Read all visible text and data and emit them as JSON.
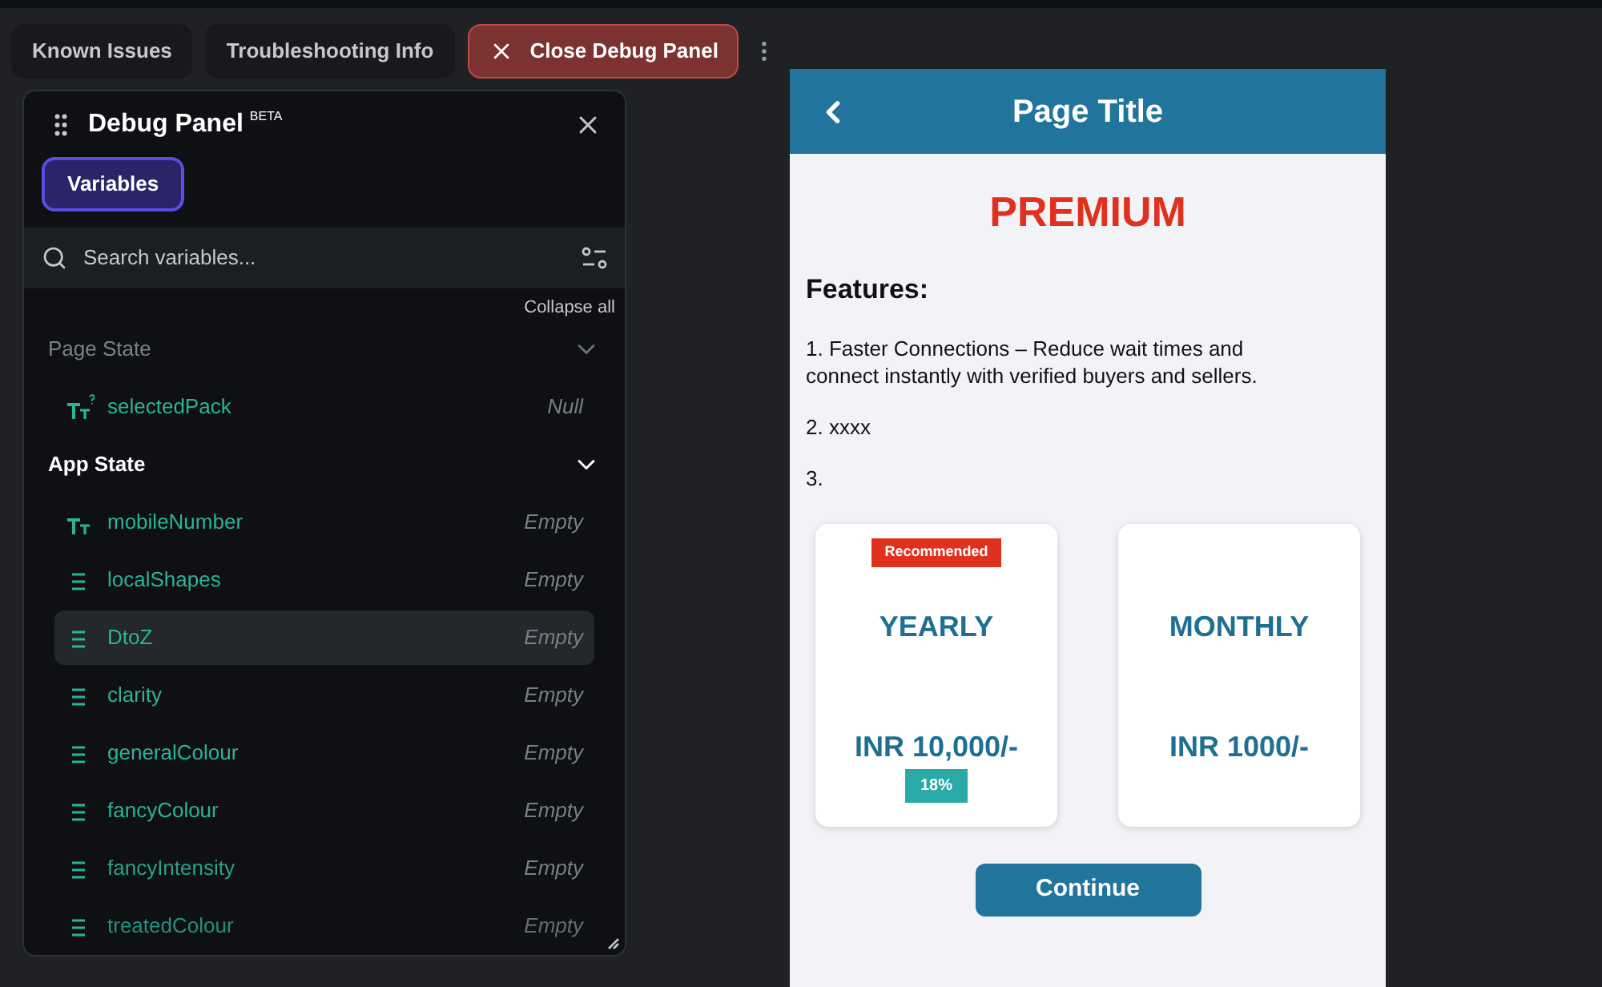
{
  "toolbar": {
    "buttons": [
      {
        "label": "Known Issues",
        "kind": "plain"
      },
      {
        "label": "Troubleshooting Info",
        "kind": "plain"
      },
      {
        "label": "Close Debug Panel",
        "kind": "danger"
      }
    ]
  },
  "debug_panel": {
    "title": "Debug Panel",
    "badge": "BETA",
    "tabs": [
      {
        "label": "Variables",
        "selected": true
      }
    ],
    "search": {
      "placeholder": "Search variables..."
    },
    "collapse_all": "Collapse all",
    "sections": [
      {
        "title": "Page State",
        "active": false,
        "items": [
          {
            "name": "selectedPack",
            "kind": "text",
            "nullable": true,
            "value": "Null",
            "selected": false
          }
        ]
      },
      {
        "title": "App State",
        "active": true,
        "items": [
          {
            "name": "mobileNumber",
            "kind": "text",
            "nullable": false,
            "value": "Empty",
            "selected": false
          },
          {
            "name": "localShapes",
            "kind": "list",
            "nullable": false,
            "value": "Empty",
            "selected": false
          },
          {
            "name": "DtoZ",
            "kind": "list",
            "nullable": false,
            "value": "Empty",
            "selected": true
          },
          {
            "name": "clarity",
            "kind": "list",
            "nullable": false,
            "value": "Empty",
            "selected": false
          },
          {
            "name": "generalColour",
            "kind": "list",
            "nullable": false,
            "value": "Empty",
            "selected": false
          },
          {
            "name": "fancyColour",
            "kind": "list",
            "nullable": false,
            "value": "Empty",
            "selected": false
          },
          {
            "name": "fancyIntensity",
            "kind": "list",
            "nullable": false,
            "value": "Empty",
            "selected": false
          },
          {
            "name": "treatedColour",
            "kind": "list",
            "nullable": false,
            "value": "Empty",
            "selected": false
          }
        ]
      }
    ]
  },
  "phone": {
    "title": "Page Title",
    "heading": "PREMIUM",
    "features_title": "Features:",
    "features": [
      "1. Faster Connections – Reduce wait times and connect instantly with verified buyers and sellers.",
      "2. xxxx",
      "3."
    ],
    "plans": [
      {
        "badge": "Recommended",
        "name": "YEARLY",
        "price": "INR 10,000/-",
        "tag": "18%"
      },
      {
        "name": "MONTHLY",
        "price": "INR 1000/-"
      }
    ],
    "button": "Continue"
  }
}
